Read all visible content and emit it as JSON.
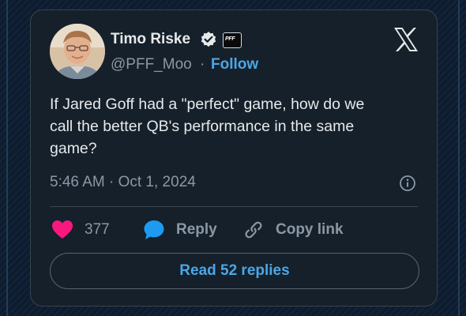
{
  "author": {
    "name": "Timo Riske",
    "handle": "@PFF_Moo",
    "separator": "·",
    "follow_label": "Follow",
    "affiliate_badge": "PFF"
  },
  "tweet": {
    "lines": [
      "If Jared Goff had a \"perfect\" game, how do we",
      "call the better QB's performance in the same",
      "game?"
    ],
    "timestamp": "5:46 AM · Oct 1, 2024"
  },
  "actions": {
    "likes_count": "377",
    "reply_label": "Reply",
    "copy_link_label": "Copy link"
  },
  "read_replies_label": "Read 52 replies",
  "colors": {
    "background": "#15202b",
    "accent": "#4aa7e6",
    "like": "#f91880",
    "text": "#e7e9ea",
    "muted": "#8b98a5"
  },
  "icons": [
    "verified-icon",
    "pff-affiliate-icon",
    "x-logo-icon",
    "info-icon",
    "heart-icon",
    "speech-bubble-icon",
    "link-icon"
  ]
}
